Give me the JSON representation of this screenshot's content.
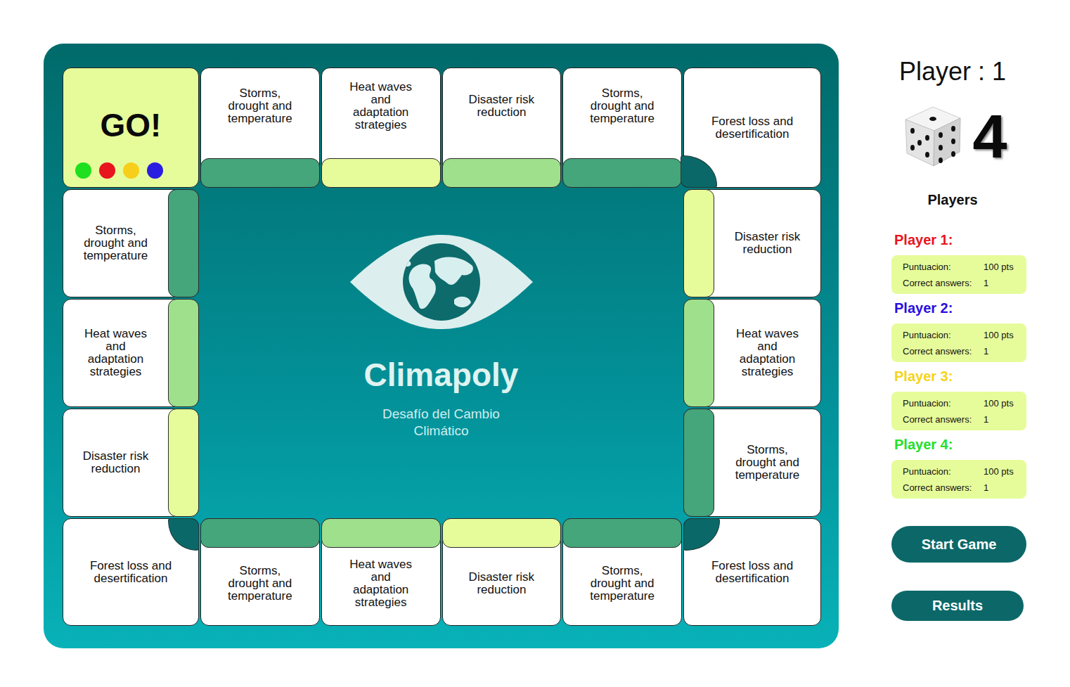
{
  "game": {
    "title": "Climapoly",
    "subtitle": "Desafío del Cambio Climático"
  },
  "board": {
    "top": [
      {
        "kind": "go",
        "text": "GO!",
        "tokens": [
          {
            "color": "#1ee01e"
          },
          {
            "color": "#e8141e"
          },
          {
            "color": "#f7cf1a"
          },
          {
            "color": "#2a1ee0"
          }
        ]
      },
      {
        "kind": "space",
        "text": "Storms, drought and temperature",
        "color": "#45a57b"
      },
      {
        "kind": "space",
        "text": "Heat waves and adaptation strategies",
        "color": "#e6fc9a"
      },
      {
        "kind": "space",
        "text": "Disaster risk reduction",
        "color": "#9fe08d"
      },
      {
        "kind": "space",
        "text": "Storms, drought and temperature",
        "color": "#45a57b"
      },
      {
        "kind": "corner",
        "text": "Forest loss and desertification"
      }
    ],
    "left": [
      {
        "kind": "space",
        "text": "Storms, drought and temperature",
        "color": "#45a57b"
      },
      {
        "kind": "space",
        "text": "Heat waves and adaptation strategies",
        "color": "#9fe08d"
      },
      {
        "kind": "space",
        "text": "Disaster risk reduction",
        "color": "#e6fc9a"
      }
    ],
    "right": [
      {
        "kind": "space",
        "text": "Disaster risk reduction",
        "color": "#e6fc9a"
      },
      {
        "kind": "space",
        "text": "Heat waves and adaptation strategies",
        "color": "#9fe08d"
      },
      {
        "kind": "space",
        "text": "Storms, drought and temperature",
        "color": "#45a57b"
      }
    ],
    "bottom": [
      {
        "kind": "corner",
        "text": "Forest loss and desertification"
      },
      {
        "kind": "space",
        "text": "Storms, drought and temperature",
        "color": "#45a57b"
      },
      {
        "kind": "space",
        "text": "Heat waves and adaptation strategies",
        "color": "#9fe08d"
      },
      {
        "kind": "space",
        "text": "Disaster risk reduction",
        "color": "#e6fc9a"
      },
      {
        "kind": "space",
        "text": "Storms, drought and temperature",
        "color": "#45a57b"
      },
      {
        "kind": "corner",
        "text": "Forest loss and desertification"
      }
    ]
  },
  "turn": {
    "label": "Player : 1",
    "dice": "4"
  },
  "players_heading": "Players",
  "players": [
    {
      "name": "Player 1:",
      "color": "#e8141e",
      "score_label": "Puntuacion:",
      "score": "100 pts",
      "answers_label": "Correct answers:",
      "answers": "1"
    },
    {
      "name": "Player 2:",
      "color": "#2a0ee0",
      "score_label": "Puntuacion:",
      "score": "100 pts",
      "answers_label": "Correct answers:",
      "answers": "1"
    },
    {
      "name": "Player 3:",
      "color": "#f5d41b",
      "score_label": "Puntuacion:",
      "score": "100 pts",
      "answers_label": "Correct answers:",
      "answers": "1"
    },
    {
      "name": "Player 4:",
      "color": "#24e02a",
      "score_label": "Puntuacion:",
      "score": "100 pts",
      "answers_label": "Correct answers:",
      "answers": "1"
    }
  ],
  "buttons": [
    {
      "label": "Start Game"
    },
    {
      "label": "Results"
    }
  ]
}
